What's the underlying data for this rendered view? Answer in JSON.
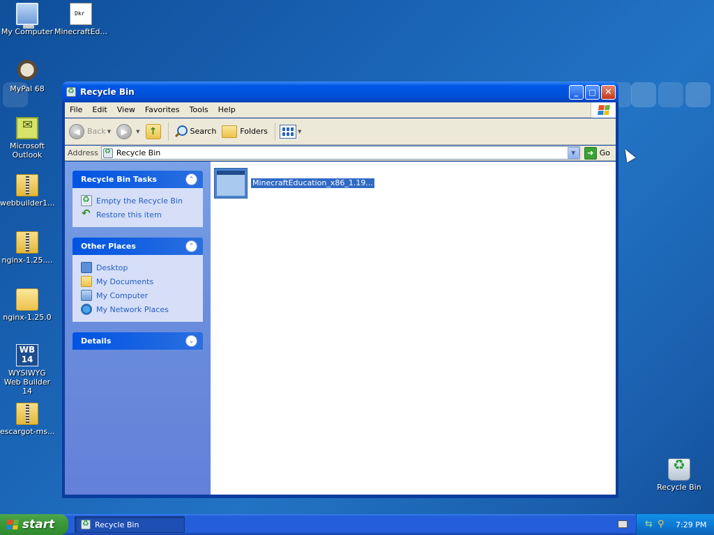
{
  "desktop": {
    "icons": [
      {
        "label": "My Computer",
        "icon": "computer-icon"
      },
      {
        "label": "MinecraftEd...",
        "icon": "document-icon"
      },
      {
        "label": "MyPal 68",
        "icon": "raccoon-browser-icon"
      },
      {
        "label": "Microsoft Outlook",
        "icon": "outlook-icon"
      },
      {
        "label": "webbuilder1...",
        "icon": "zip-folder-icon"
      },
      {
        "label": "nginx-1.25....",
        "icon": "zip-folder-icon"
      },
      {
        "label": "nginx-1.25.0",
        "icon": "folder-icon"
      },
      {
        "label": "WYSIWYG Web Builder 14",
        "icon": "wb14-icon"
      },
      {
        "label": "escargot-ms...",
        "icon": "zip-folder-icon"
      },
      {
        "label": "Recycle Bin",
        "icon": "recycle-bin-icon"
      }
    ]
  },
  "window": {
    "title": "Recycle Bin",
    "menu": [
      "File",
      "Edit",
      "View",
      "Favorites",
      "Tools",
      "Help"
    ],
    "toolbar": {
      "back": "Back",
      "search": "Search",
      "folders": "Folders"
    },
    "address": {
      "label": "Address",
      "value": "Recycle Bin",
      "go": "Go"
    },
    "tasks_panel": {
      "title": "Recycle Bin Tasks",
      "items": [
        "Empty the Recycle Bin",
        "Restore this item"
      ]
    },
    "places_panel": {
      "title": "Other Places",
      "items": [
        "Desktop",
        "My Documents",
        "My Computer",
        "My Network Places"
      ]
    },
    "details_panel": {
      "title": "Details"
    },
    "files": [
      {
        "name": "MinecraftEducation_x86_1.19...",
        "selected": true
      }
    ]
  },
  "taskbar": {
    "start_label": "start",
    "tasks": [
      "Recycle Bin"
    ],
    "clock": "7:29 PM"
  },
  "colors": {
    "titlebar": "#0050d8",
    "selection": "#316ac5",
    "taskbar": "#245edb",
    "start_button": "#3c9a3a"
  }
}
